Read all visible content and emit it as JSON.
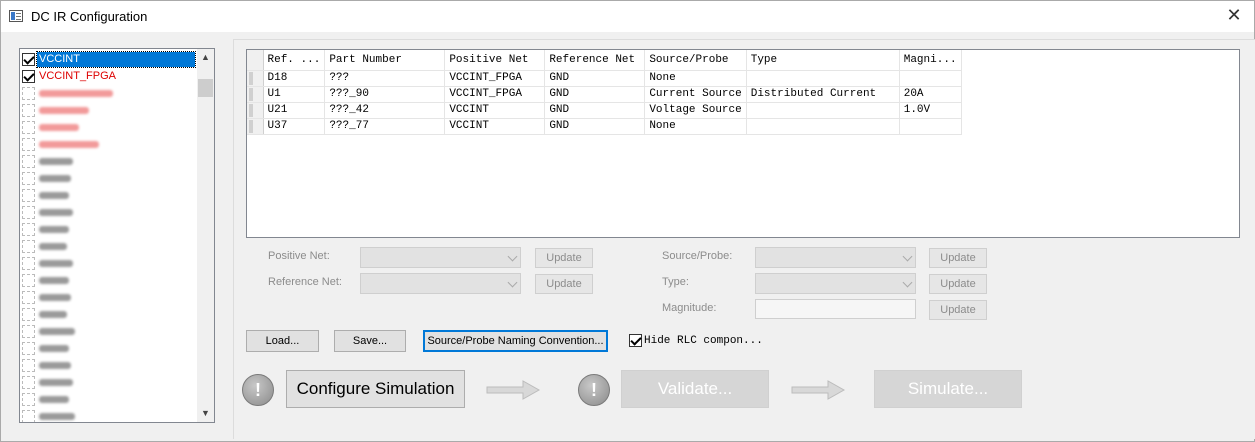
{
  "window": {
    "title": "DC IR Configuration",
    "close_glyph": "✕",
    "icon": "app-window-icon"
  },
  "net_list": {
    "items": [
      {
        "label": "VCCINT",
        "checked": true,
        "selected": true,
        "color": "#ffffff"
      },
      {
        "label": "VCCINT_FPGA",
        "checked": true,
        "selected": false,
        "color": "#d00000"
      }
    ]
  },
  "grid": {
    "columns": [
      "Ref. ...",
      "Part Number",
      "Positive Net",
      "Reference Net",
      "Source/Probe",
      "Type",
      "Magni..."
    ],
    "rows": [
      [
        "D18",
        "???",
        "VCCINT_FPGA",
        "GND",
        "None",
        "",
        ""
      ],
      [
        "U1",
        "???_90",
        "VCCINT_FPGA",
        "GND",
        "Current Source",
        "Distributed Current",
        "20A"
      ],
      [
        "U21",
        "???_42",
        "VCCINT",
        "GND",
        "Voltage Source",
        "",
        "1.0V"
      ],
      [
        "U37",
        "???_77",
        "VCCINT",
        "GND",
        "None",
        "",
        ""
      ]
    ]
  },
  "editor": {
    "positive_net_label": "Positive Net:",
    "reference_net_label": "Reference Net:",
    "source_probe_label": "Source/Probe:",
    "type_label": "Type:",
    "magnitude_label": "Magnitude:",
    "update_label": "Update"
  },
  "actions": {
    "load": "Load...",
    "save": "Save...",
    "naming": "Source/Probe Naming Convention...",
    "hide_rlc": "Hide RLC compon...",
    "hide_rlc_checked": true
  },
  "workflow": {
    "warn_glyph": "!",
    "configure": "Configure Simulation",
    "validate": "Validate...",
    "simulate": "Simulate..."
  }
}
